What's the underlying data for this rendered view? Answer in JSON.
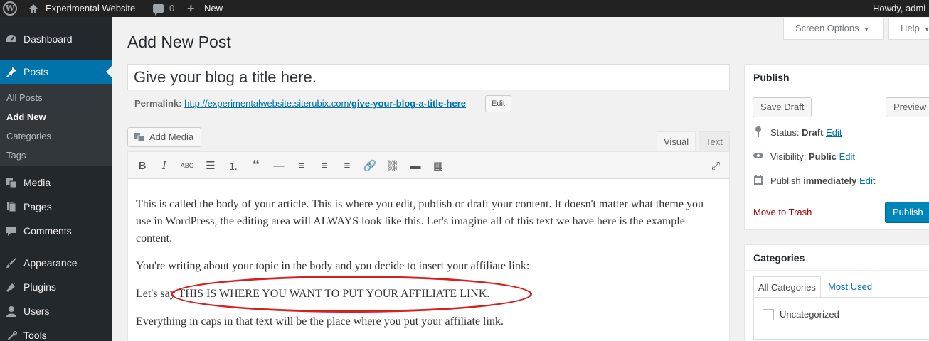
{
  "admin_bar": {
    "site_name": "Experimental Website",
    "comments_count": "0",
    "new_label": "New",
    "howdy": "Howdy, admi"
  },
  "sidebar": {
    "items": [
      {
        "label": "Dashboard",
        "icon": "dashboard-icon"
      },
      {
        "label": "Posts",
        "icon": "pin-icon"
      },
      {
        "label": "Media",
        "icon": "media-icon"
      },
      {
        "label": "Pages",
        "icon": "pages-icon"
      },
      {
        "label": "Comments",
        "icon": "comments-icon"
      },
      {
        "label": "Appearance",
        "icon": "brush-icon"
      },
      {
        "label": "Plugins",
        "icon": "plugin-icon"
      },
      {
        "label": "Users",
        "icon": "users-icon"
      },
      {
        "label": "Tools",
        "icon": "tools-icon"
      }
    ],
    "submenu": [
      "All Posts",
      "Add New",
      "Categories",
      "Tags"
    ]
  },
  "screen_options": "Screen Options",
  "help": "Help",
  "page_title": "Add New Post",
  "post_title": "Give your blog a title here.",
  "permalink": {
    "label": "Permalink:",
    "url_base": "http://experimentalwebsite.siterubix.com/",
    "slug": "give-your-blog-a-title-here",
    "edit_label": "Edit"
  },
  "add_media": "Add Media",
  "editor_tabs": {
    "visual": "Visual",
    "text": "Text"
  },
  "content": {
    "p1": "This is called the body of your article. This is where you edit, publish or draft your content. It doesn't matter what theme you use in WordPress, the editing area will ALWAYS look like this. Let's imagine all of this text we have here is the example content.",
    "p2": "You're writing about your topic in the body and you decide to insert your affiliate link:",
    "p3": "Let's say THIS IS WHERE YOU WANT TO PUT YOUR AFFILIATE LINK.",
    "p4": "Everything in caps in that text will be the place where you put your affiliate link."
  },
  "publish_box": {
    "title": "Publish",
    "save_draft": "Save Draft",
    "preview": "Preview",
    "status_label": "Status:",
    "status_value": "Draft",
    "visibility_label": "Visibility:",
    "visibility_value": "Public",
    "publish_label": "Publish",
    "publish_value": "immediately",
    "edit": "Edit",
    "trash": "Move to Trash",
    "publish_button": "Publish"
  },
  "categories_box": {
    "title": "Categories",
    "tab_all": "All Categories",
    "tab_used": "Most Used",
    "items": [
      "Uncategorized"
    ]
  },
  "colors": {
    "accent": "#0073aa",
    "sidebar_bg": "#23282d",
    "annotation": "#d61f1f"
  }
}
